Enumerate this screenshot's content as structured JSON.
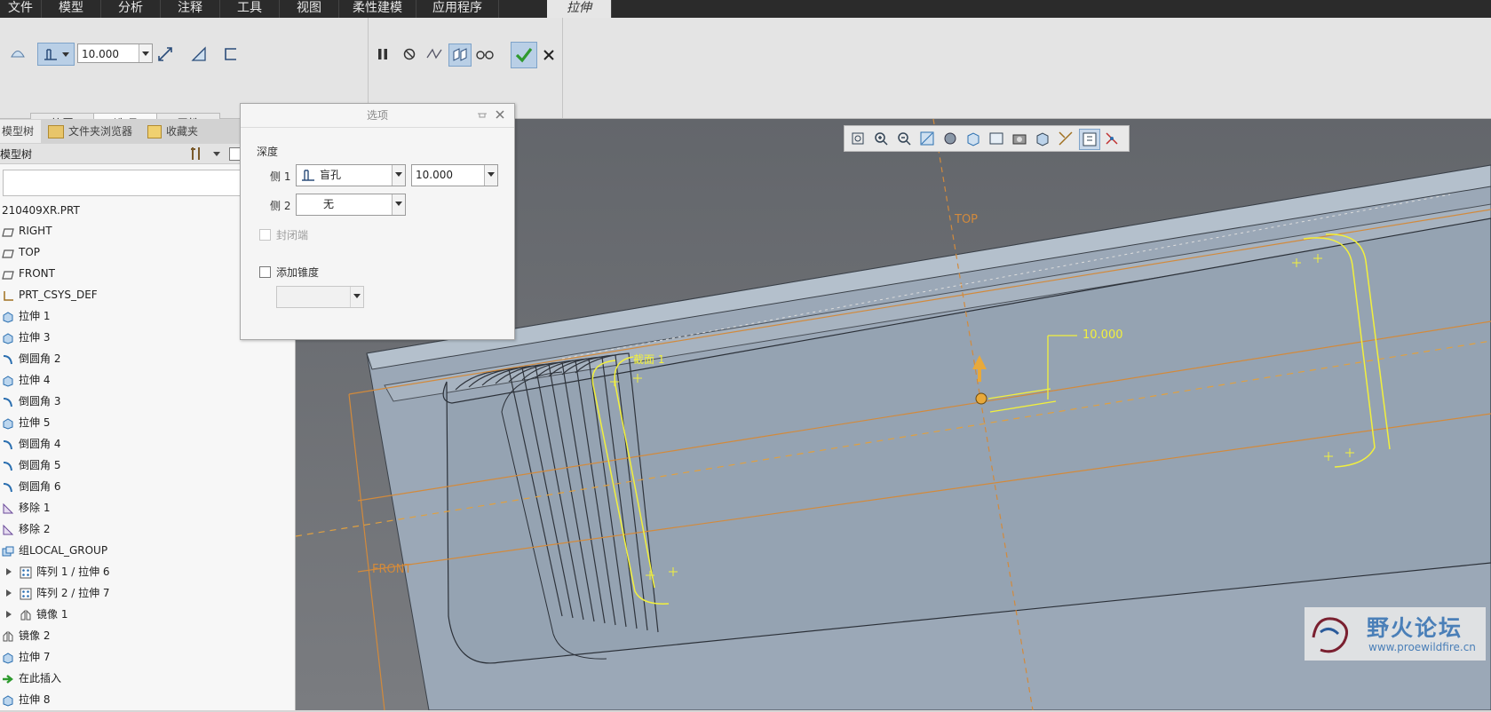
{
  "menubar": {
    "tabs": [
      "文件",
      "模型",
      "分析",
      "注释",
      "工具",
      "视图",
      "柔性建模",
      "应用程序",
      "拉伸"
    ],
    "active_tab": "拉伸"
  },
  "ribbon": {
    "depth_value": "10.000",
    "subtabs": [
      "放置",
      "选项",
      "属性"
    ],
    "active_subtab": "选项"
  },
  "left_panel": {
    "tabs": [
      "模型树",
      "文件夹浏览器",
      "收藏夹"
    ],
    "header": "模型树",
    "root": "210409XR.PRT",
    "items": [
      {
        "label": "RIGHT",
        "icon": "datum-plane-icon"
      },
      {
        "label": "TOP",
        "icon": "datum-plane-icon"
      },
      {
        "label": "FRONT",
        "icon": "datum-plane-icon"
      },
      {
        "label": "PRT_CSYS_DEF",
        "icon": "csys-icon"
      },
      {
        "label": "拉伸 1",
        "icon": "extrude-icon"
      },
      {
        "label": "拉伸 3",
        "icon": "extrude-icon"
      },
      {
        "label": "倒圆角 2",
        "icon": "round-icon"
      },
      {
        "label": "拉伸 4",
        "icon": "extrude-icon"
      },
      {
        "label": "倒圆角 3",
        "icon": "round-icon"
      },
      {
        "label": "拉伸 5",
        "icon": "extrude-icon"
      },
      {
        "label": "倒圆角 4",
        "icon": "round-icon"
      },
      {
        "label": "倒圆角 5",
        "icon": "round-icon"
      },
      {
        "label": "倒圆角 6",
        "icon": "round-icon"
      },
      {
        "label": "移除 1",
        "icon": "remove-icon"
      },
      {
        "label": "移除 2",
        "icon": "remove-icon"
      },
      {
        "label": "组LOCAL_GROUP",
        "icon": "group-icon"
      },
      {
        "label": "阵列 1 / 拉伸 6",
        "icon": "pattern-icon",
        "expandable": true
      },
      {
        "label": "阵列 2 / 拉伸 7",
        "icon": "pattern-icon",
        "expandable": true
      },
      {
        "label": "镜像 1",
        "icon": "mirror-icon",
        "expandable": true
      },
      {
        "label": "镜像 2",
        "icon": "mirror-icon"
      },
      {
        "label": "拉伸 7",
        "icon": "extrude-icon"
      },
      {
        "label": "在此插入",
        "icon": "insert-here-icon"
      },
      {
        "label": "拉伸 8",
        "icon": "extrude-icon"
      }
    ]
  },
  "options_dialog": {
    "title": "选项",
    "depth_label": "深度",
    "side1_label": "侧 1",
    "side1_type": "盲孔",
    "side1_value": "10.000",
    "side2_label": "侧 2",
    "side2_type": "无",
    "capped_ends_label": "封闭端",
    "add_taper_label": "添加锥度"
  },
  "viewport": {
    "plane_labels": {
      "top": "TOP",
      "front": "FRONT"
    },
    "section_label": "截面 1",
    "dimension_value": "10.000",
    "watermark_title": "野火论坛",
    "watermark_url": "www.proewildfire.cn"
  },
  "colors": {
    "accent_yellow": "#f2f03c",
    "datum_orange": "#d28a3c",
    "model_face": "#9aa7b6",
    "confirm_green": "#3aa63a"
  }
}
